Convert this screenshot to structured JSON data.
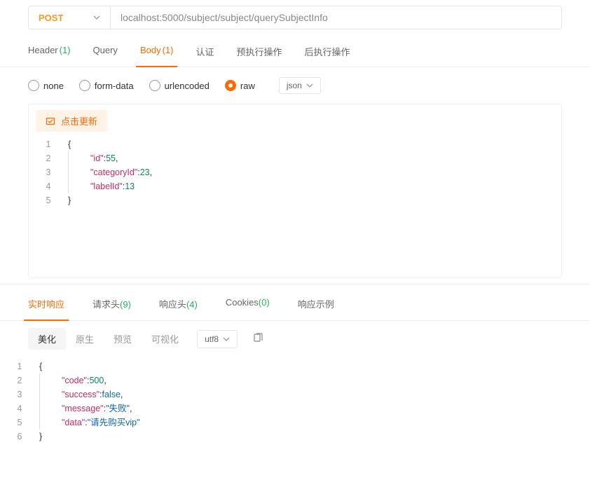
{
  "request": {
    "method": "POST",
    "url": "localhost:5000/subject/subject/querySubjectInfo"
  },
  "tabs": {
    "header": {
      "label": "Header",
      "count": "(1)"
    },
    "query": {
      "label": "Query"
    },
    "body": {
      "label": "Body",
      "count": "(1)"
    },
    "auth": {
      "label": "认证"
    },
    "pre": {
      "label": "预执行操作"
    },
    "post": {
      "label": "后执行操作"
    }
  },
  "bodyTypes": {
    "none": "none",
    "formData": "form-data",
    "urlencoded": "urlencoded",
    "raw": "raw",
    "format": "json"
  },
  "updateBtn": "点击更新",
  "requestBody": {
    "lines": [
      {
        "n": "1",
        "t": "open"
      },
      {
        "n": "2",
        "key": "\"id\"",
        "val": "55",
        "vt": "num",
        "comma": true
      },
      {
        "n": "3",
        "key": "\"categoryId\"",
        "val": "23",
        "vt": "num",
        "comma": true
      },
      {
        "n": "4",
        "key": "\"labelId\"",
        "val": "13",
        "vt": "num",
        "comma": false
      },
      {
        "n": "5",
        "t": "close"
      }
    ]
  },
  "responseTabs": {
    "realtime": {
      "label": "实时响应"
    },
    "reqHeaders": {
      "label": "请求头",
      "count": "(9)"
    },
    "respHeaders": {
      "label": "响应头",
      "count": "(4)"
    },
    "cookies": {
      "label": "Cookies",
      "count": "(0)"
    },
    "example": {
      "label": "响应示例"
    }
  },
  "viewModes": {
    "beautify": "美化",
    "raw": "原生",
    "preview": "预览",
    "visual": "可视化",
    "encoding": "utf8"
  },
  "responseBody": {
    "lines": [
      {
        "n": "1",
        "t": "open"
      },
      {
        "n": "2",
        "key": "\"code\"",
        "val": "500",
        "vt": "num",
        "comma": true
      },
      {
        "n": "3",
        "key": "\"success\"",
        "val": "false",
        "vt": "bool",
        "comma": true
      },
      {
        "n": "4",
        "key": "\"message\"",
        "val": "\"失败\"",
        "vt": "str",
        "comma": true
      },
      {
        "n": "5",
        "key": "\"data\"",
        "val": "\"请先购买vip\"",
        "vt": "str",
        "comma": false
      },
      {
        "n": "6",
        "t": "close"
      }
    ]
  }
}
